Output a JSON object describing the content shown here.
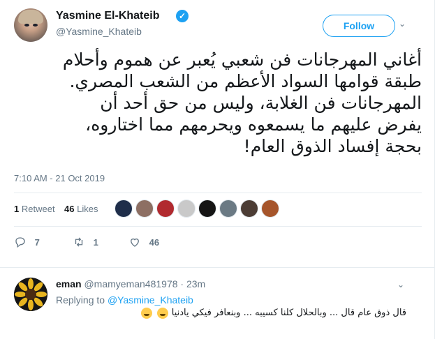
{
  "tweet": {
    "author_name": "Yasmine El-Khateib",
    "handle": "@Yasmine_Khateib",
    "follow_label": "Follow",
    "text_lines": [
      "أغاني المهرجانات فن شعبي يُعبر عن هموم وأحلام",
      "طبقة قوامها السواد الأعظم من الشعب المصري.",
      "المهرجانات فن الغلابة، وليس من حق أحد أن",
      "يفرض عليهم ما يسمعوه ويحرمهم مما اختاروه،",
      "بحجة إفساد الذوق العام!"
    ],
    "timestamp": "7:10 AM - 21 Oct 2019",
    "retweet_count": "1",
    "retweet_label": "Retweet",
    "like_count": "46",
    "like_label": "Likes",
    "actions": {
      "reply_count": "7",
      "retweet_count": "1",
      "like_count": "46"
    },
    "icons": [
      "verified-badge-icon",
      "chevron-down-icon",
      "reply-icon",
      "retweet-icon",
      "heart-icon"
    ],
    "colors": {
      "accent": "#1da1f2",
      "muted": "#657786",
      "text": "#14171a",
      "divider": "#e6ecf0"
    }
  },
  "reply": {
    "author_name": "eman",
    "handle": "@mamyeman481978",
    "time": "23m",
    "replying_prefix": "Replying to",
    "replying_to": "@Yasmine_Khateib",
    "text": "قال ذوق عام قال ... وبالحلال كلنا كسيبه ... وبنعافر فيكي يادنيا",
    "emoji": [
      "face-with-tears-of-joy",
      "winking-face-with-tongue"
    ]
  }
}
